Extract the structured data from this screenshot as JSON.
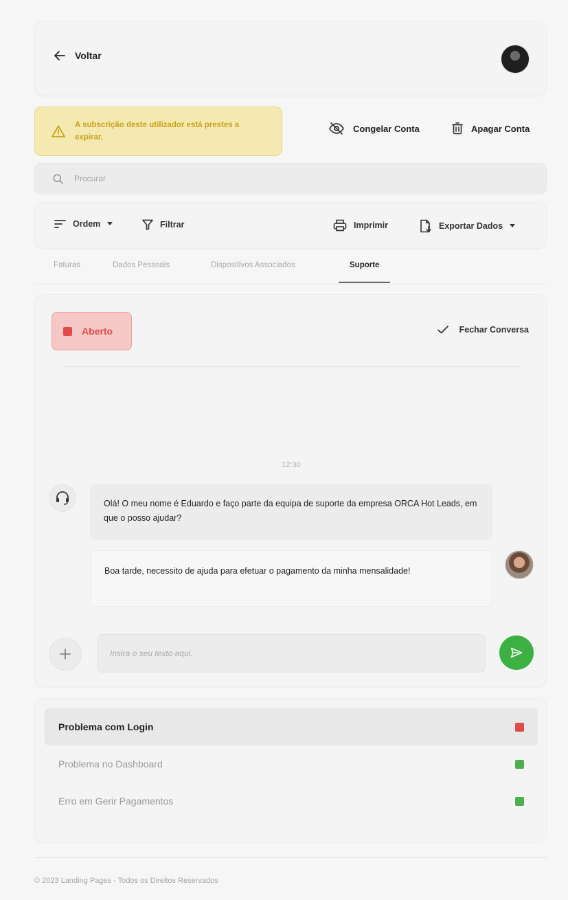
{
  "header": {
    "back_label": "Voltar"
  },
  "warning": {
    "text": "A subscrição deste utilizador está prestes a expirar."
  },
  "account_actions": {
    "freeze_label": "Congelar Conta",
    "delete_label": "Apagar Conta"
  },
  "search": {
    "placeholder": "Procurar"
  },
  "toolbar": {
    "order_label": "Ordem",
    "filter_label": "Filtrar",
    "print_label": "Imprimir",
    "export_label": "Exportar Dados"
  },
  "tabs": [
    {
      "label": "Faturas"
    },
    {
      "label": "Dados Pessoais"
    },
    {
      "label": "Dispositivos Associados"
    },
    {
      "label": "Suporte",
      "active": true
    }
  ],
  "chat": {
    "status_label": "Aberto",
    "close_label": "Fechar Conversa",
    "time": "12:30",
    "messages": [
      {
        "from": "support",
        "text": "Olá! O meu nome é Eduardo e faço parte da equipa de suporte da empresa ORCA Hot Leads, em que o posso ajudar?"
      },
      {
        "from": "user",
        "text": "Boa tarde, necessito de ajuda para efetuar o pagamento da minha mensalidade!"
      }
    ],
    "input_placeholder": "Insira o seu texto aqui."
  },
  "tickets": [
    {
      "label": "Problema com Login",
      "status_color": "#e14b4b"
    },
    {
      "label": "Problema no Dashboard",
      "status_color": "#4caf50"
    },
    {
      "label": "Erro em Gerir Pagamentos",
      "status_color": "#4caf50"
    }
  ],
  "footer": {
    "text": "© 2023 Landing Pages - Todos os Direitos Reservados"
  },
  "colors": {
    "accent_green": "#3cb043",
    "status_red": "#e14b4b",
    "warning_bg": "#f4e9b0",
    "warning_text": "#c9a21e"
  }
}
